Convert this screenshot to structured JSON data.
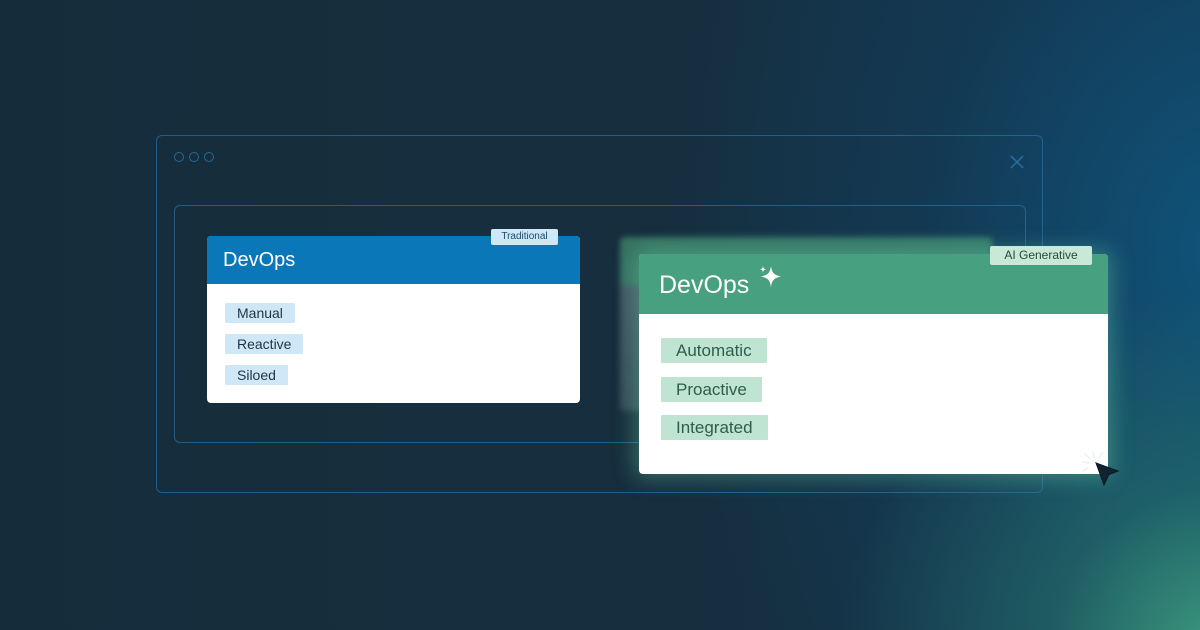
{
  "colors": {
    "background": "#152d3b",
    "traditional_header": "#0a77b8",
    "ai_header": "#47a080",
    "traditional_tag_bg": "#cfe8f7",
    "ai_tag_bg": "#bfe5d2",
    "window_outline": "#286ea0"
  },
  "window": {
    "controls": [
      "circle-icon",
      "circle-icon",
      "circle-icon"
    ],
    "close_icon": "close-icon"
  },
  "traditional_card": {
    "badge": "Traditional",
    "title": "DevOps",
    "tags": [
      "Manual",
      "Reactive",
      "Siloed"
    ]
  },
  "ai_card": {
    "badge": "AI Generative",
    "title": "DevOps",
    "title_icon": "sparkle-icon",
    "tags": [
      "Automatic",
      "Proactive",
      "Integrated"
    ]
  },
  "pointer": {
    "icon": "mouse-pointer-click-icon"
  }
}
